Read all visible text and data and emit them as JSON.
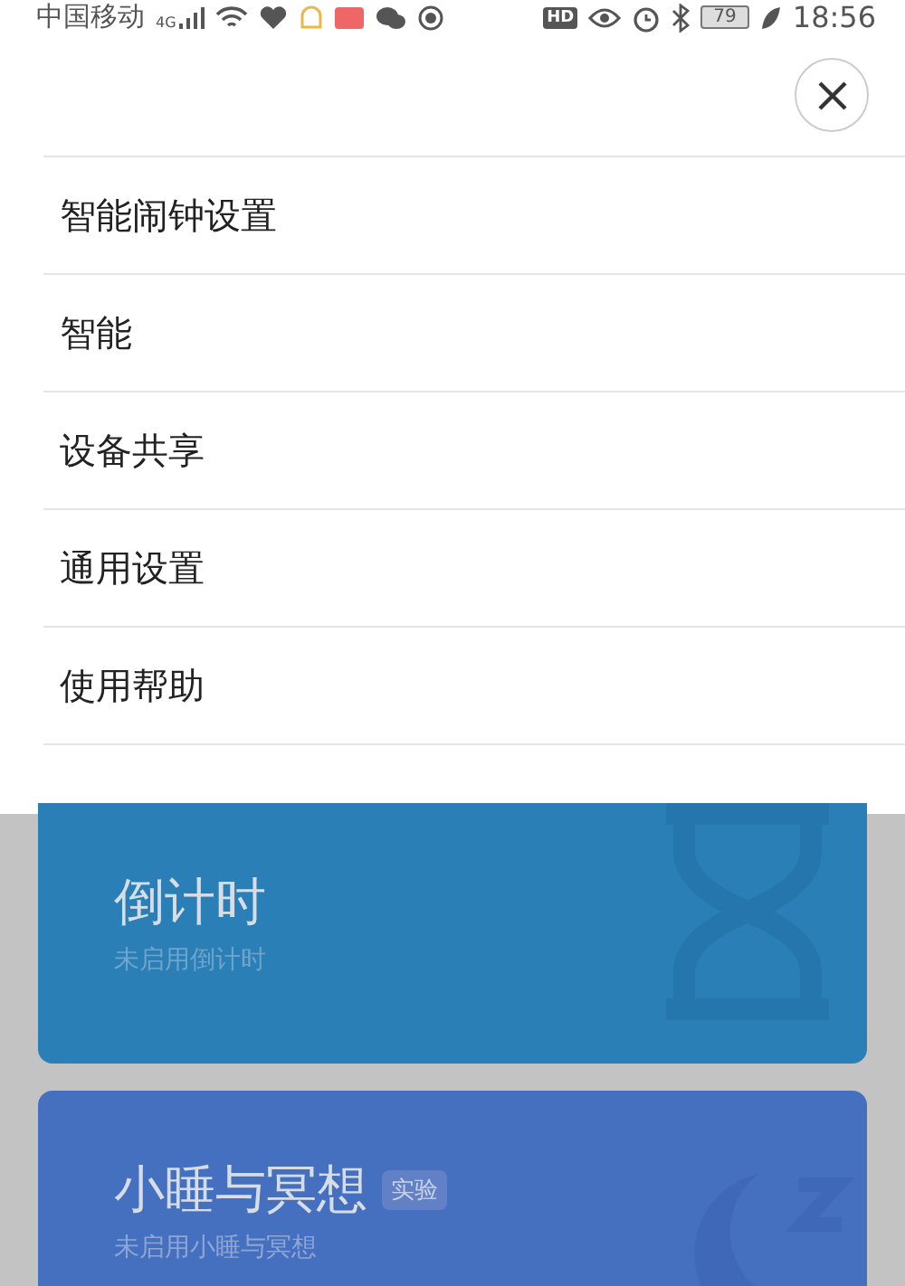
{
  "status_bar": {
    "carrier": "中国移动",
    "network": "4G",
    "hd": "HD",
    "battery": "79",
    "time": "18:56"
  },
  "menu": {
    "items": [
      {
        "label": "智能闹钟设置"
      },
      {
        "label": "智能"
      },
      {
        "label": "设备共享"
      },
      {
        "label": "通用设置"
      },
      {
        "label": "使用帮助"
      }
    ]
  },
  "cards": [
    {
      "kind": "timer",
      "title": "倒计时",
      "subtitle": "未启用倒计时"
    },
    {
      "kind": "nap",
      "title": "小睡与冥想",
      "badge": "实验",
      "subtitle": "未启用小睡与冥想"
    }
  ]
}
